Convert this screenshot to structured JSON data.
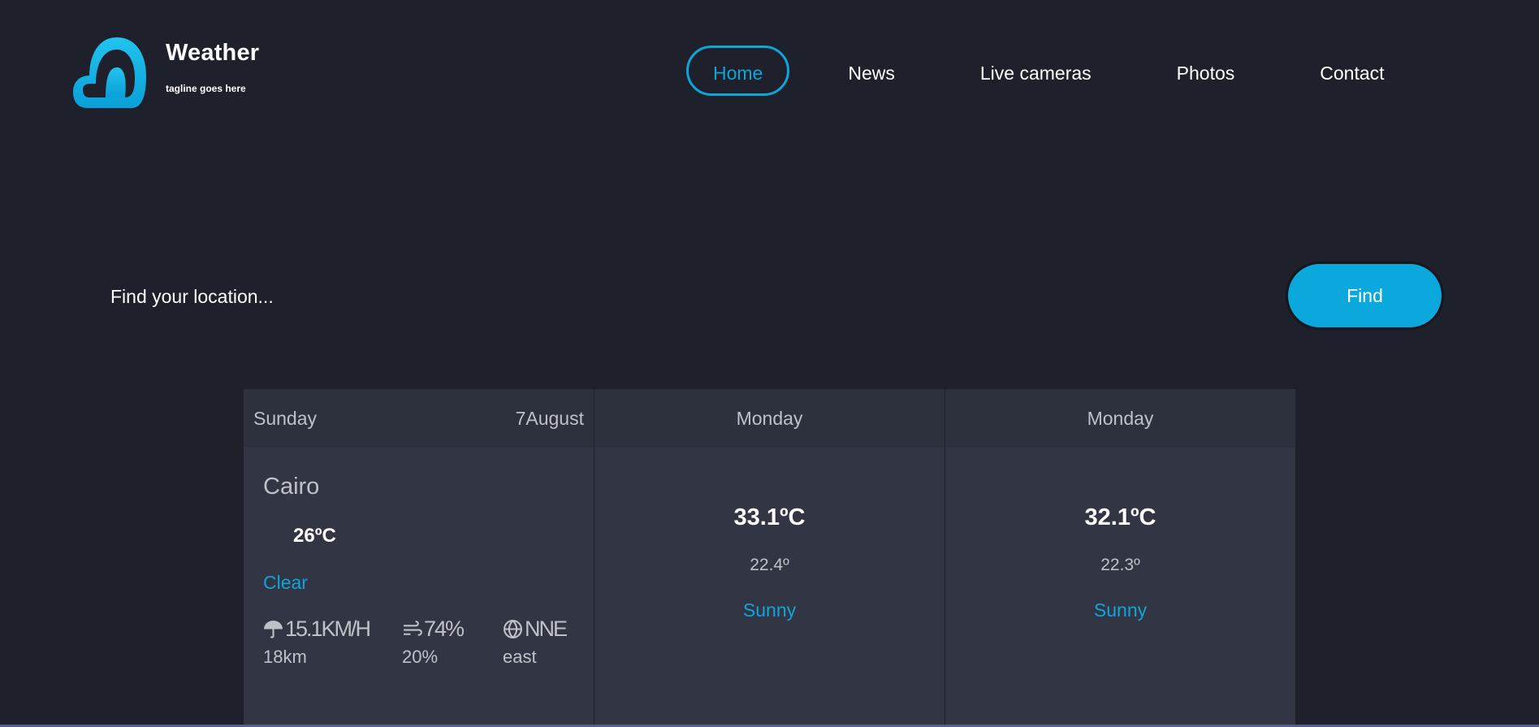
{
  "brand": {
    "title": "Weather",
    "tagline": "tagline goes here",
    "logo_icon": "cloud-icon",
    "accent_color": "#0ea5d8"
  },
  "nav": {
    "items": [
      {
        "label": "Home",
        "active": true
      },
      {
        "label": "News",
        "active": false
      },
      {
        "label": "Live cameras",
        "active": false
      },
      {
        "label": "Photos",
        "active": false
      },
      {
        "label": "Contact",
        "active": false
      }
    ]
  },
  "search": {
    "placeholder": "Find your location...",
    "value": "",
    "button_label": "Find"
  },
  "forecast": {
    "today": {
      "day": "Sunday",
      "date": "7August",
      "city": "Cairo",
      "temp": "26ºC",
      "condition": "Clear",
      "stats": [
        {
          "icon": "umbrella-icon",
          "value": "15.1KM/H",
          "sub": "18km"
        },
        {
          "icon": "wind-icon",
          "value": "74%",
          "sub": "20%"
        },
        {
          "icon": "compass-icon",
          "value": "NNE",
          "sub": "east"
        }
      ]
    },
    "days": [
      {
        "day": "Monday",
        "max": "33.1ºC",
        "min": "22.4º",
        "condition": "Sunny"
      },
      {
        "day": "Monday",
        "max": "32.1ºC",
        "min": "22.3º",
        "condition": "Sunny"
      }
    ]
  }
}
